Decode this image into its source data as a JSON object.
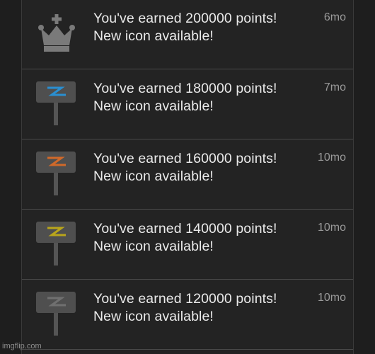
{
  "notifications": [
    {
      "title": "You've earned 200000 points!",
      "body": "New icon available!",
      "time": "6mo",
      "icon": "crown-icon",
      "color": "#7a7a7a"
    },
    {
      "title": "You've earned 180000 points!",
      "body": "New icon available!",
      "time": "7mo",
      "icon": "signpost-icon",
      "color": "#2a8fd1"
    },
    {
      "title": "You've earned 160000 points!",
      "body": "New icon available!",
      "time": "10mo",
      "icon": "signpost-icon",
      "color": "#d0692a"
    },
    {
      "title": "You've earned 140000 points!",
      "body": "New icon available!",
      "time": "10mo",
      "icon": "signpost-icon",
      "color": "#b9a51b"
    },
    {
      "title": "You've earned 120000 points!",
      "body": "New icon available!",
      "time": "10mo",
      "icon": "signpost-icon",
      "color": "#707070"
    }
  ],
  "watermark": "imgflip.com"
}
